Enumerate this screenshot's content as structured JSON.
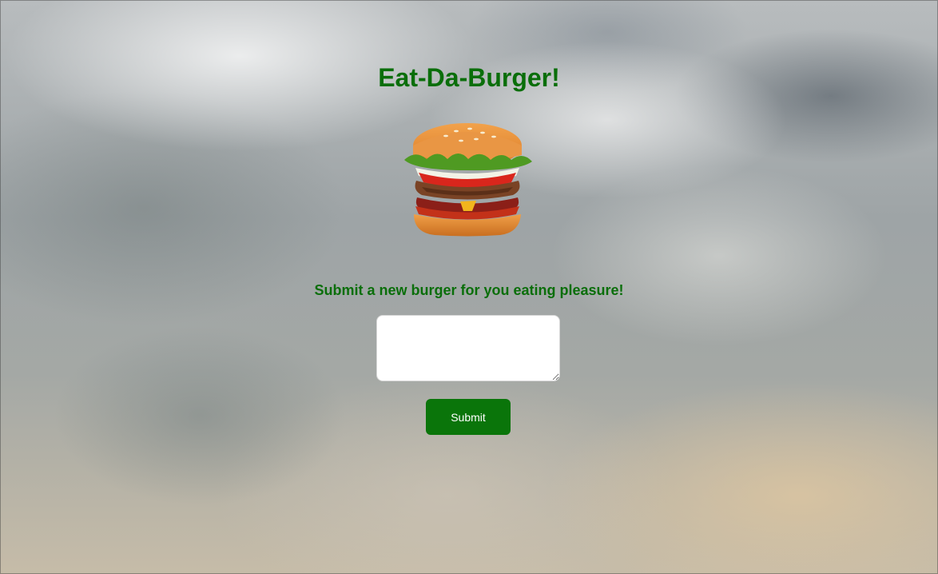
{
  "page": {
    "title": "Eat-Da-Burger!",
    "subtitle": "Submit a new burger for you eating pleasure!"
  },
  "hero": {
    "image_name": "burger-image"
  },
  "form": {
    "input_value": "",
    "submit_label": "Submit"
  },
  "colors": {
    "accent": "#0a6e0a",
    "button": "#0a750a"
  }
}
